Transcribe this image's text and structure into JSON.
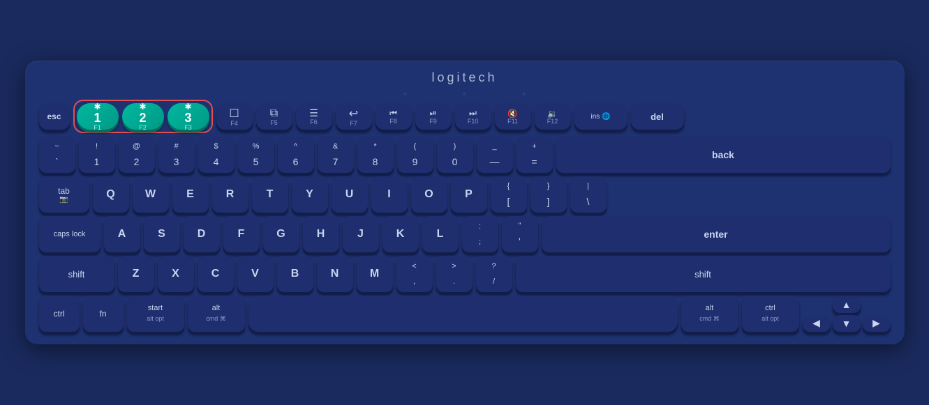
{
  "logo": "logitech",
  "keyboard": {
    "fn_row": {
      "keys": [
        {
          "id": "esc",
          "label": "esc",
          "type": "text-sm"
        },
        {
          "id": "bt1",
          "label": "1",
          "fn": "F1",
          "type": "bt"
        },
        {
          "id": "bt2",
          "label": "2",
          "fn": "F2",
          "type": "bt"
        },
        {
          "id": "bt3",
          "label": "3",
          "fn": "F3",
          "type": "bt"
        },
        {
          "id": "f4",
          "icon": "☐",
          "fn": "F4",
          "type": "icon"
        },
        {
          "id": "f5",
          "icon": "⧉",
          "fn": "F5",
          "type": "icon"
        },
        {
          "id": "f6",
          "icon": "≡",
          "fn": "F6",
          "type": "icon"
        },
        {
          "id": "f7",
          "icon": "↩",
          "fn": "F7",
          "type": "icon"
        },
        {
          "id": "f8",
          "icon": "◀◀",
          "fn": "F8",
          "type": "icon"
        },
        {
          "id": "f9",
          "icon": "▶⏸",
          "fn": "F9",
          "type": "icon"
        },
        {
          "id": "f10",
          "icon": "▶▶",
          "fn": "F10",
          "type": "icon"
        },
        {
          "id": "f11",
          "icon": "🔇",
          "fn": "F11",
          "type": "icon"
        },
        {
          "id": "f12",
          "icon": "🔉",
          "fn": "F12",
          "type": "icon"
        },
        {
          "id": "ins",
          "label": "ins",
          "sub": "🌐",
          "type": "ins"
        },
        {
          "id": "del",
          "label": "del",
          "type": "text"
        }
      ]
    },
    "num_row": {
      "keys": [
        {
          "sym": "~",
          "num": "`"
        },
        {
          "sym": "!",
          "num": "1"
        },
        {
          "sym": "@",
          "num": "2"
        },
        {
          "sym": "#",
          "num": "3"
        },
        {
          "sym": "$",
          "num": "4"
        },
        {
          "sym": "%",
          "num": "5"
        },
        {
          "sym": "^",
          "num": "6"
        },
        {
          "sym": "&",
          "num": "7"
        },
        {
          "sym": "*",
          "num": "8"
        },
        {
          "sym": "(",
          "num": "9"
        },
        {
          "sym": ")",
          "num": "0"
        },
        {
          "sym": "_",
          "num": "—"
        },
        {
          "sym": "+",
          "num": "="
        }
      ]
    },
    "rows": {
      "tab_row": [
        "Q",
        "W",
        "E",
        "R",
        "T",
        "Y",
        "U",
        "I",
        "O",
        "P"
      ],
      "caps_row": [
        "A",
        "S",
        "D",
        "F",
        "G",
        "H",
        "J",
        "K",
        "L"
      ],
      "shift_row": [
        "Z",
        "X",
        "C",
        "V",
        "B",
        "N",
        "M"
      ]
    },
    "labels": {
      "back": "back",
      "tab": "tab",
      "caps": "caps lock",
      "enter": "enter",
      "lshift": "shift",
      "rshift": "shift",
      "ctrl_l": "ctrl",
      "fn": "fn",
      "start": "start\nalt opt",
      "alt": "alt\ncmd ⌘",
      "alt_r": "alt\ncmd ⌘",
      "ctrl_r": "ctrl\nalt opt"
    }
  }
}
